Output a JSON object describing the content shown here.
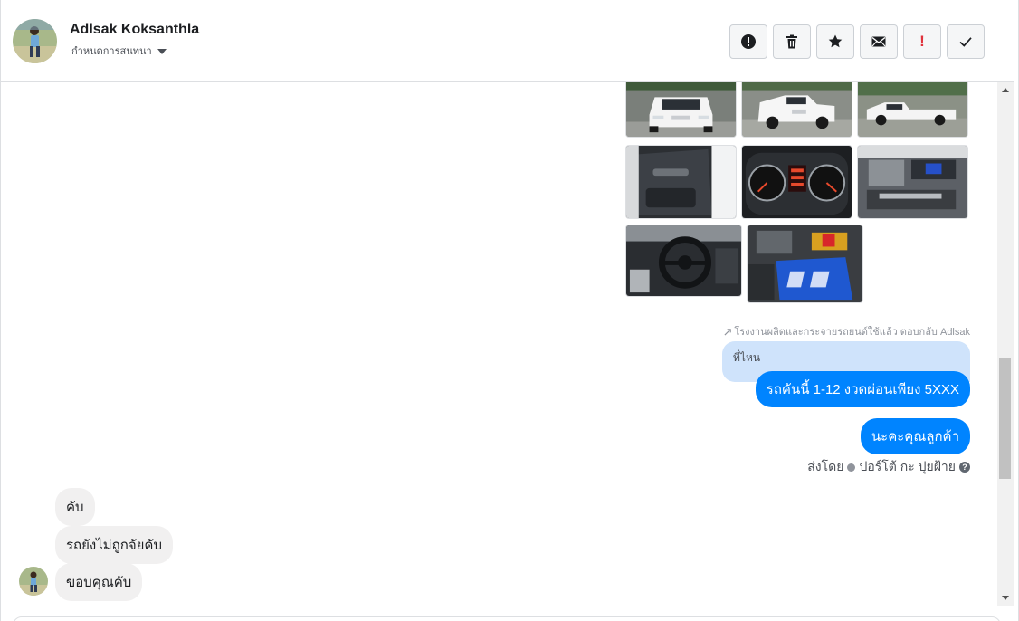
{
  "header": {
    "contact_name": "Adlsak Koksanthla",
    "subtitle": "กำหนดการสนทนา",
    "actions": [
      {
        "name": "report-button",
        "icon": "exclamation-circle-icon"
      },
      {
        "name": "delete-button",
        "icon": "trash-icon"
      },
      {
        "name": "star-button",
        "icon": "star-icon"
      },
      {
        "name": "mark-unread-button",
        "icon": "envelope-icon"
      },
      {
        "name": "mark-spam-button",
        "icon": "red-exclamation-icon"
      },
      {
        "name": "mark-done-button",
        "icon": "checkmark-icon"
      }
    ]
  },
  "messages": {
    "reply_note": "โรงงานผลิตและกระจายรถยนต์ใช้แล้ว ตอบกลับ Adlsak",
    "quoted_text": "ที่ไหน",
    "outgoing": [
      "รถคันนี้ 1-12 งวดผ่อนเพียง 5XXX",
      "นะคะคุณลูกค้า"
    ],
    "sent_by_label": "ส่งโดย",
    "sent_by_name": "ปอร์โต้ กะ ปุยฝ้าย",
    "help_glyph": "?",
    "incoming": [
      "คับ",
      "รถยังไม่ถูกจัยคับ",
      "ขอบคุณคับ"
    ]
  },
  "photos": [
    {
      "name": "photo-white-pickup-front",
      "subject": "white pickup front view"
    },
    {
      "name": "photo-white-pickup-side",
      "subject": "white pickup angled view"
    },
    {
      "name": "photo-white-pickup-lot",
      "subject": "white pickup in lot"
    },
    {
      "name": "photo-door-interior",
      "subject": "door interior"
    },
    {
      "name": "photo-dashboard-gauges",
      "subject": "instrument cluster"
    },
    {
      "name": "photo-engine-bay",
      "subject": "engine bay"
    },
    {
      "name": "photo-steering-wheel",
      "subject": "steering wheel"
    },
    {
      "name": "photo-engine-blue-cover",
      "subject": "engine with blue cover"
    }
  ],
  "colors": {
    "accent": "#0084ff",
    "quoted_bg": "#cfe3fb",
    "incoming_bg": "#f1f0f0"
  }
}
